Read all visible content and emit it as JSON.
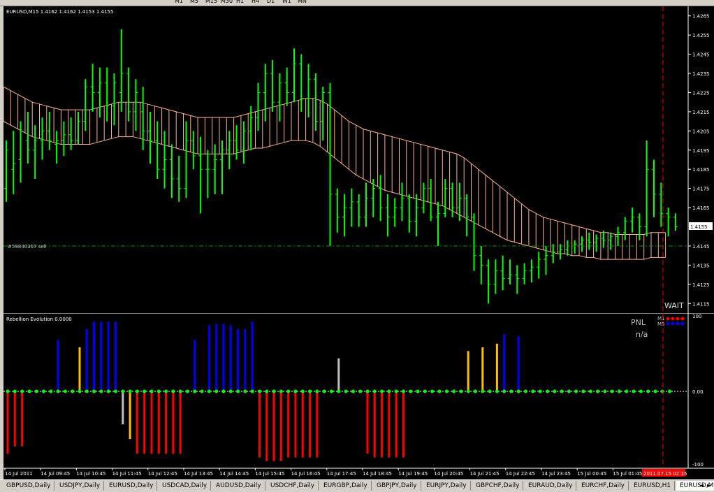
{
  "toolbar": {
    "timeframes": [
      "M1",
      "M5",
      "M15",
      "M30",
      "H1",
      "H4",
      "D1",
      "W1",
      "MN"
    ]
  },
  "price_chart": {
    "header": "EURUSD,M15  1.4162 1.4162 1.4153 1.4155",
    "order_label": "#59840367 sell",
    "status_label": "WAIT",
    "current_price": "1.4155",
    "price_ticks": [
      "1.4265",
      "1.4255",
      "1.4245",
      "1.4235",
      "1.4225",
      "1.4215",
      "1.4205",
      "1.4195",
      "1.4185",
      "1.4175",
      "1.4165",
      "1.4145",
      "1.4135",
      "1.4125",
      "1.4115"
    ],
    "colors": {
      "background": "#000000",
      "bars": "#00ff00",
      "band": "#ffb090",
      "order_line": "#00a000",
      "vline": "#ff0000"
    }
  },
  "indicator": {
    "header": "Rebellion Evolution 0.0000",
    "pnl_label": "PNL",
    "pnl_value": "n/a",
    "legend_m1": "M1",
    "legend_m5": "M5",
    "ticks": [
      "100",
      "0.00",
      "-100"
    ],
    "colors": {
      "blue": "#0000ff",
      "red": "#ff0000",
      "yellow": "#ffc000",
      "gray": "#c0c0c0",
      "dot": "#00ff00"
    }
  },
  "time_axis": {
    "labels": [
      "14 Jul 2011",
      "14 Jul 09:45",
      "14 Jul 10:45",
      "14 Jul 11:45",
      "14 Jul 12:45",
      "14 Jul 13:45",
      "14 Jul 14:45",
      "14 Jul 15:45",
      "14 Jul 16:45",
      "14 Jul 17:45",
      "14 Jul 18:45",
      "14 Jul 19:45",
      "14 Jul 20:45",
      "14 Jul 21:45",
      "14 Jul 22:45",
      "14 Jul 23:45",
      "15 Jul 00:45",
      "15 Jul 01:45"
    ],
    "current_time": "2011.07.15 02:15"
  },
  "tabs": [
    {
      "label": "GBPUSD,Daily"
    },
    {
      "label": "USDJPY,Daily"
    },
    {
      "label": "EURUSD,Daily"
    },
    {
      "label": "USDCAD,Daily"
    },
    {
      "label": "AUDUSD,Daily"
    },
    {
      "label": "USDCHF,Daily"
    },
    {
      "label": "EURGBP,Daily"
    },
    {
      "label": "GBPJPY,Daily"
    },
    {
      "label": "EURJPY,Daily"
    },
    {
      "label": "GBPCHF,Daily"
    },
    {
      "label": "EURAUD,Daily"
    },
    {
      "label": "EURCHF,Daily"
    },
    {
      "label": "EURUSD,H1"
    },
    {
      "label": "EURUSD,M5"
    },
    {
      "label": "E"
    }
  ],
  "chart_data": {
    "type": "bar",
    "title": "EURUSD,M15",
    "ylim": [
      1.411,
      1.427
    ],
    "ohlc": [
      [
        1.4175,
        1.42,
        1.4168,
        1.4195
      ],
      [
        1.4185,
        1.4205,
        1.4172,
        1.4188
      ],
      [
        1.419,
        1.421,
        1.4178,
        1.4205
      ],
      [
        1.42,
        1.4215,
        1.4188,
        1.4195
      ],
      [
        1.4195,
        1.4208,
        1.418,
        1.42
      ],
      [
        1.42,
        1.4212,
        1.419,
        1.4205
      ],
      [
        1.4205,
        1.4215,
        1.4195,
        1.42
      ],
      [
        1.4198,
        1.4205,
        1.4188,
        1.42
      ],
      [
        1.42,
        1.421,
        1.4192,
        1.4203
      ],
      [
        1.4203,
        1.4212,
        1.4195,
        1.42
      ],
      [
        1.42,
        1.4215,
        1.4198,
        1.421
      ],
      [
        1.421,
        1.4232,
        1.4205,
        1.4228
      ],
      [
        1.4228,
        1.424,
        1.4215,
        1.4225
      ],
      [
        1.4225,
        1.4238,
        1.4212,
        1.423
      ],
      [
        1.423,
        1.4238,
        1.421,
        1.4218
      ],
      [
        1.4218,
        1.4235,
        1.4208,
        1.423
      ],
      [
        1.4225,
        1.4258,
        1.4215,
        1.4235
      ],
      [
        1.4235,
        1.4238,
        1.421,
        1.4215
      ],
      [
        1.4215,
        1.4232,
        1.4205,
        1.4225
      ],
      [
        1.4215,
        1.4228,
        1.4195,
        1.4205
      ],
      [
        1.4205,
        1.4215,
        1.4188,
        1.42
      ],
      [
        1.42,
        1.421,
        1.418,
        1.4185
      ],
      [
        1.4185,
        1.4205,
        1.4175,
        1.419
      ],
      [
        1.419,
        1.4198,
        1.417,
        1.418
      ],
      [
        1.418,
        1.4192,
        1.4168,
        1.4175
      ],
      [
        1.4175,
        1.421,
        1.417,
        1.42
      ],
      [
        1.42,
        1.4205,
        1.4185,
        1.4192
      ],
      [
        1.4192,
        1.4202,
        1.4162,
        1.4185
      ],
      [
        1.4185,
        1.4195,
        1.417,
        1.4185
      ],
      [
        1.4185,
        1.4198,
        1.4172,
        1.419
      ],
      [
        1.419,
        1.42,
        1.4172,
        1.4195
      ],
      [
        1.4195,
        1.4205,
        1.4185,
        1.42
      ],
      [
        1.42,
        1.4208,
        1.419,
        1.4195
      ],
      [
        1.4195,
        1.421,
        1.4188,
        1.4205
      ],
      [
        1.4205,
        1.4218,
        1.4195,
        1.4212
      ],
      [
        1.4212,
        1.423,
        1.4205,
        1.4225
      ],
      [
        1.4225,
        1.424,
        1.421,
        1.4235
      ],
      [
        1.4235,
        1.4242,
        1.4215,
        1.422
      ],
      [
        1.422,
        1.4235,
        1.421,
        1.423
      ],
      [
        1.423,
        1.4238,
        1.4218,
        1.4225
      ],
      [
        1.4225,
        1.4248,
        1.422,
        1.424
      ],
      [
        1.424,
        1.4245,
        1.4215,
        1.4222
      ],
      [
        1.4222,
        1.424,
        1.4212,
        1.4232
      ],
      [
        1.4232,
        1.4235,
        1.4205,
        1.421
      ],
      [
        1.421,
        1.4228,
        1.42,
        1.4225
      ],
      [
        1.4225,
        1.423,
        1.4145,
        1.4172
      ],
      [
        1.4172,
        1.4175,
        1.4152,
        1.416
      ],
      [
        1.416,
        1.4172,
        1.415,
        1.4165
      ],
      [
        1.4165,
        1.4175,
        1.4155,
        1.4168
      ],
      [
        1.4168,
        1.4172,
        1.4155,
        1.416
      ],
      [
        1.416,
        1.4178,
        1.4155,
        1.417
      ],
      [
        1.417,
        1.418,
        1.416,
        1.4175
      ],
      [
        1.4175,
        1.4182,
        1.4158,
        1.4165
      ],
      [
        1.4165,
        1.4172,
        1.415,
        1.416
      ],
      [
        1.416,
        1.417,
        1.4155,
        1.4165
      ],
      [
        1.4165,
        1.4178,
        1.4158,
        1.417
      ],
      [
        1.417,
        1.4172,
        1.4152,
        1.4158
      ],
      [
        1.4158,
        1.4172,
        1.415,
        1.4165
      ],
      [
        1.4165,
        1.4178,
        1.4162,
        1.4175
      ],
      [
        1.4175,
        1.418,
        1.4158,
        1.416
      ],
      [
        1.416,
        1.4168,
        1.4145,
        1.4162
      ],
      [
        1.4162,
        1.418,
        1.416,
        1.4175
      ],
      [
        1.4175,
        1.4178,
        1.416,
        1.4165
      ],
      [
        1.4165,
        1.4178,
        1.4158,
        1.417
      ],
      [
        1.417,
        1.4172,
        1.415,
        1.416
      ],
      [
        1.416,
        1.4162,
        1.4132,
        1.414
      ],
      [
        1.414,
        1.4145,
        1.4125,
        1.4135
      ],
      [
        1.4135,
        1.4138,
        1.4115,
        1.4125
      ],
      [
        1.4125,
        1.4138,
        1.412,
        1.4132
      ],
      [
        1.4132,
        1.414,
        1.4122,
        1.4128
      ],
      [
        1.4128,
        1.4138,
        1.4125,
        1.413
      ],
      [
        1.413,
        1.4135,
        1.412,
        1.4128
      ],
      [
        1.4128,
        1.4136,
        1.4125,
        1.4132
      ],
      [
        1.4132,
        1.4138,
        1.4126,
        1.4134
      ],
      [
        1.4134,
        1.4142,
        1.4128,
        1.4138
      ],
      [
        1.4138,
        1.4145,
        1.413,
        1.414
      ],
      [
        1.414,
        1.4146,
        1.4136,
        1.4142
      ],
      [
        1.4142,
        1.4146,
        1.4138,
        1.4143
      ],
      [
        1.4143,
        1.4148,
        1.414,
        1.4145
      ],
      [
        1.4145,
        1.4148,
        1.4141,
        1.4146
      ],
      [
        1.4146,
        1.415,
        1.4142,
        1.4148
      ],
      [
        1.4148,
        1.4152,
        1.4143,
        1.4147
      ],
      [
        1.4147,
        1.4151,
        1.4142,
        1.4149
      ],
      [
        1.4149,
        1.4153,
        1.4144,
        1.4148
      ],
      [
        1.4148,
        1.4152,
        1.4143,
        1.415
      ],
      [
        1.415,
        1.4155,
        1.4145,
        1.4152
      ],
      [
        1.4152,
        1.416,
        1.4148,
        1.4158
      ],
      [
        1.4158,
        1.4165,
        1.4152,
        1.416
      ],
      [
        1.416,
        1.4162,
        1.4148,
        1.4155
      ],
      [
        1.4155,
        1.42,
        1.415,
        1.4185
      ],
      [
        1.4185,
        1.419,
        1.416,
        1.4172
      ],
      [
        1.4172,
        1.4178,
        1.4155,
        1.4162
      ],
      [
        1.4162,
        1.4165,
        1.415,
        1.416
      ],
      [
        1.416,
        1.4162,
        1.4153,
        1.4155
      ]
    ],
    "band_upper": [
      1.4228,
      1.4226,
      1.4224,
      1.4222,
      1.422,
      1.4219,
      1.4218,
      1.4217,
      1.4216,
      1.4216,
      1.4216,
      1.4216,
      1.4216,
      1.4217,
      1.4218,
      1.4219,
      1.422,
      1.422,
      1.422,
      1.422,
      1.4219,
      1.4218,
      1.4217,
      1.4216,
      1.4215,
      1.4214,
      1.4213,
      1.4212,
      1.4212,
      1.4212,
      1.4212,
      1.4212,
      1.4212,
      1.4213,
      1.4214,
      1.4215,
      1.4216,
      1.4217,
      1.4218,
      1.4219,
      1.422,
      1.4221,
      1.4222,
      1.4222,
      1.4221,
      1.4219,
      1.4216,
      1.4213,
      1.421,
      1.4208,
      1.4206,
      1.4205,
      1.4204,
      1.4203,
      1.4202,
      1.4201,
      1.42,
      1.4199,
      1.4198,
      1.4197,
      1.4196,
      1.4195,
      1.4194,
      1.4193,
      1.4191,
      1.4188,
      1.4185,
      1.4182,
      1.4179,
      1.4176,
      1.4173,
      1.417,
      1.4167,
      1.4164,
      1.4162,
      1.416,
      1.4159,
      1.4158,
      1.4157,
      1.4156,
      1.4155,
      1.4154,
      1.4153,
      1.4152,
      1.4152,
      1.4151,
      1.4151,
      1.4151,
      1.4151,
      1.4151,
      1.4152,
      1.4152,
      1.4152
    ],
    "band_lower": [
      1.421,
      1.4208,
      1.4206,
      1.4204,
      1.4202,
      1.4201,
      1.42,
      1.4199,
      1.4198,
      1.4198,
      1.4198,
      1.4198,
      1.4198,
      1.4199,
      1.42,
      1.4201,
      1.4202,
      1.4202,
      1.4202,
      1.4201,
      1.42,
      1.4199,
      1.4198,
      1.4197,
      1.4196,
      1.4195,
      1.4194,
      1.4193,
      1.4193,
      1.4193,
      1.4193,
      1.4193,
      1.4193,
      1.4194,
      1.4195,
      1.4196,
      1.4196,
      1.4197,
      1.4198,
      1.4199,
      1.42,
      1.42,
      1.42,
      1.4199,
      1.4197,
      1.4194,
      1.4191,
      1.4188,
      1.4185,
      1.4182,
      1.418,
      1.4178,
      1.4176,
      1.4174,
      1.4173,
      1.4172,
      1.4171,
      1.417,
      1.4169,
      1.4168,
      1.4167,
      1.4166,
      1.4164,
      1.4162,
      1.416,
      1.4158,
      1.4156,
      1.4154,
      1.4152,
      1.415,
      1.4148,
      1.4147,
      1.4146,
      1.4145,
      1.4144,
      1.4143,
      1.4142,
      1.4141,
      1.4141,
      1.414,
      1.414,
      1.4139,
      1.4139,
      1.4138,
      1.4138,
      1.4138,
      1.4138,
      1.4138,
      1.4138,
      1.4138,
      1.4139,
      1.4139,
      1.4139
    ],
    "order_price": 1.4145,
    "indicator_values": [
      -100,
      -100,
      -100,
      0,
      0,
      0,
      0,
      0,
      0,
      0,
      0,
      0,
      0,
      0,
      0,
      0,
      0,
      0,
      0,
      0,
      0,
      0,
      0,
      0,
      0,
      0,
      0,
      0,
      0,
      0,
      0,
      0,
      0,
      0,
      0,
      0,
      0,
      0,
      0,
      0,
      0,
      0,
      0,
      0,
      0,
      0,
      0,
      0,
      0,
      0,
      0,
      0,
      0,
      0,
      0,
      0,
      0,
      0,
      0,
      0,
      0,
      0,
      0,
      0,
      0,
      0,
      0,
      0,
      0,
      0,
      0,
      0,
      0,
      0,
      0,
      0,
      0,
      0,
      0,
      0,
      0,
      0,
      0,
      0,
      0,
      0,
      0,
      0,
      0,
      0,
      0,
      0,
      0
    ],
    "indicator_bars": [
      {
        "x": 0,
        "v": -85,
        "c": "red"
      },
      {
        "x": 1,
        "v": -75,
        "c": "red"
      },
      {
        "x": 2,
        "v": -75,
        "c": "red"
      },
      {
        "x": 7,
        "v": 70,
        "c": "blue"
      },
      {
        "x": 10,
        "v": 60,
        "c": "yellow"
      },
      {
        "x": 11,
        "v": 85,
        "c": "blue"
      },
      {
        "x": 12,
        "v": 95,
        "c": "blue"
      },
      {
        "x": 13,
        "v": 95,
        "c": "blue"
      },
      {
        "x": 14,
        "v": 95,
        "c": "blue"
      },
      {
        "x": 15,
        "v": 95,
        "c": "blue"
      },
      {
        "x": 16,
        "v": -45,
        "c": "gray"
      },
      {
        "x": 17,
        "v": -65,
        "c": "yellow"
      },
      {
        "x": 18,
        "v": -85,
        "c": "red"
      },
      {
        "x": 19,
        "v": -85,
        "c": "red"
      },
      {
        "x": 20,
        "v": -85,
        "c": "red"
      },
      {
        "x": 21,
        "v": -85,
        "c": "red"
      },
      {
        "x": 22,
        "v": -85,
        "c": "red"
      },
      {
        "x": 23,
        "v": -85,
        "c": "red"
      },
      {
        "x": 24,
        "v": -85,
        "c": "red"
      },
      {
        "x": 26,
        "v": 70,
        "c": "blue"
      },
      {
        "x": 28,
        "v": 90,
        "c": "blue"
      },
      {
        "x": 29,
        "v": 92,
        "c": "blue"
      },
      {
        "x": 30,
        "v": 92,
        "c": "blue"
      },
      {
        "x": 31,
        "v": 90,
        "c": "blue"
      },
      {
        "x": 32,
        "v": 85,
        "c": "blue"
      },
      {
        "x": 33,
        "v": 85,
        "c": "blue"
      },
      {
        "x": 34,
        "v": 95,
        "c": "blue"
      },
      {
        "x": 35,
        "v": -90,
        "c": "red"
      },
      {
        "x": 36,
        "v": -95,
        "c": "red"
      },
      {
        "x": 37,
        "v": -95,
        "c": "red"
      },
      {
        "x": 38,
        "v": -95,
        "c": "red"
      },
      {
        "x": 39,
        "v": -90,
        "c": "red"
      },
      {
        "x": 40,
        "v": -90,
        "c": "red"
      },
      {
        "x": 41,
        "v": -90,
        "c": "red"
      },
      {
        "x": 42,
        "v": -90,
        "c": "red"
      },
      {
        "x": 43,
        "v": -90,
        "c": "red"
      },
      {
        "x": 46,
        "v": 45,
        "c": "gray"
      },
      {
        "x": 50,
        "v": -85,
        "c": "red"
      },
      {
        "x": 51,
        "v": -90,
        "c": "red"
      },
      {
        "x": 52,
        "v": -90,
        "c": "red"
      },
      {
        "x": 53,
        "v": -90,
        "c": "red"
      },
      {
        "x": 54,
        "v": -90,
        "c": "red"
      },
      {
        "x": 55,
        "v": -90,
        "c": "red"
      },
      {
        "x": 64,
        "v": 55,
        "c": "yellow"
      },
      {
        "x": 66,
        "v": 60,
        "c": "yellow"
      },
      {
        "x": 68,
        "v": 65,
        "c": "yellow"
      },
      {
        "x": 69,
        "v": 78,
        "c": "blue"
      },
      {
        "x": 71,
        "v": 75,
        "c": "blue"
      }
    ]
  }
}
